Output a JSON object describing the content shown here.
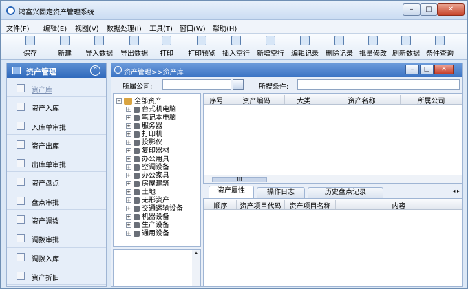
{
  "window": {
    "title": "鸿富兴固定资产管理系统",
    "controls": {
      "min": "–",
      "max": "□",
      "close": "✕"
    }
  },
  "menu": [
    "文件(F)",
    "编辑(E)",
    "视图(V)",
    "数据处理(I)",
    "工具(T)",
    "窗口(W)",
    "帮助(H)"
  ],
  "toolbar": [
    "保存",
    "新建",
    "导入数据",
    "导出数据",
    "打印",
    "打印预览",
    "插入空行",
    "新增空行",
    "编辑记录",
    "删除记录",
    "批量修改",
    "刷新数据",
    "条件查询"
  ],
  "leftnav": {
    "title": "资产管理",
    "collapse": "⌃",
    "items": [
      "资产库",
      "资产入库",
      "入库单审批",
      "资产出库",
      "出库单审批",
      "资产盘点",
      "盘点审批",
      "资产调拨",
      "调拨审批",
      "调拨入库",
      "资产折旧"
    ]
  },
  "main": {
    "breadcrumb": "资产管理>>资产库",
    "controls": {
      "min": "–",
      "max": "□",
      "close": "✕"
    },
    "filter": {
      "company_label": "所属公司:",
      "condition_label": "所搜条件:"
    },
    "tree": {
      "root": "全部资产",
      "items": [
        "台式机电脑",
        "笔记本电脑",
        "服务器",
        "打印机",
        "投影仪",
        "复印器材",
        "办公用具",
        "空调设备",
        "办公家具",
        "房屋建筑",
        "土地",
        "无形资产",
        "交通运输设备",
        "机器设备",
        "生产设备",
        "通用设备"
      ]
    },
    "grid": {
      "columns": [
        "序号",
        "资产编码",
        "大类",
        "资产名称",
        "所属公司"
      ],
      "scroll_thumb": "III"
    },
    "tabs": [
      "资产属性",
      "操作日志",
      "历史盘点记录"
    ],
    "tab_arrows": "◂ ▸",
    "grid2": {
      "columns": [
        "顺序",
        "资产项目代码",
        "资产项目名称",
        "内容"
      ]
    }
  }
}
